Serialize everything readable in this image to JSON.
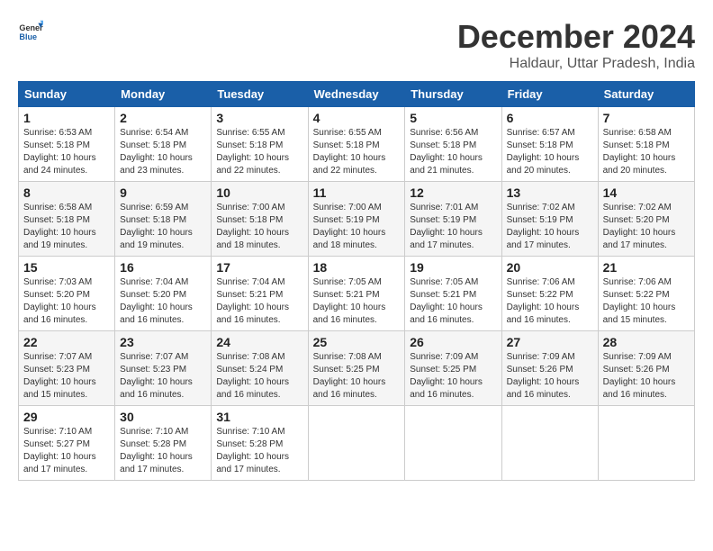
{
  "header": {
    "logo_general": "General",
    "logo_blue": "Blue",
    "title": "December 2024",
    "subtitle": "Haldaur, Uttar Pradesh, India"
  },
  "days_of_week": [
    "Sunday",
    "Monday",
    "Tuesday",
    "Wednesday",
    "Thursday",
    "Friday",
    "Saturday"
  ],
  "weeks": [
    [
      {
        "day": "1",
        "sunrise": "6:53 AM",
        "sunset": "5:18 PM",
        "daylight": "10 hours and 24 minutes."
      },
      {
        "day": "2",
        "sunrise": "6:54 AM",
        "sunset": "5:18 PM",
        "daylight": "10 hours and 23 minutes."
      },
      {
        "day": "3",
        "sunrise": "6:55 AM",
        "sunset": "5:18 PM",
        "daylight": "10 hours and 22 minutes."
      },
      {
        "day": "4",
        "sunrise": "6:55 AM",
        "sunset": "5:18 PM",
        "daylight": "10 hours and 22 minutes."
      },
      {
        "day": "5",
        "sunrise": "6:56 AM",
        "sunset": "5:18 PM",
        "daylight": "10 hours and 21 minutes."
      },
      {
        "day": "6",
        "sunrise": "6:57 AM",
        "sunset": "5:18 PM",
        "daylight": "10 hours and 20 minutes."
      },
      {
        "day": "7",
        "sunrise": "6:58 AM",
        "sunset": "5:18 PM",
        "daylight": "10 hours and 20 minutes."
      }
    ],
    [
      {
        "day": "8",
        "sunrise": "6:58 AM",
        "sunset": "5:18 PM",
        "daylight": "10 hours and 19 minutes."
      },
      {
        "day": "9",
        "sunrise": "6:59 AM",
        "sunset": "5:18 PM",
        "daylight": "10 hours and 19 minutes."
      },
      {
        "day": "10",
        "sunrise": "7:00 AM",
        "sunset": "5:18 PM",
        "daylight": "10 hours and 18 minutes."
      },
      {
        "day": "11",
        "sunrise": "7:00 AM",
        "sunset": "5:19 PM",
        "daylight": "10 hours and 18 minutes."
      },
      {
        "day": "12",
        "sunrise": "7:01 AM",
        "sunset": "5:19 PM",
        "daylight": "10 hours and 17 minutes."
      },
      {
        "day": "13",
        "sunrise": "7:02 AM",
        "sunset": "5:19 PM",
        "daylight": "10 hours and 17 minutes."
      },
      {
        "day": "14",
        "sunrise": "7:02 AM",
        "sunset": "5:20 PM",
        "daylight": "10 hours and 17 minutes."
      }
    ],
    [
      {
        "day": "15",
        "sunrise": "7:03 AM",
        "sunset": "5:20 PM",
        "daylight": "10 hours and 16 minutes."
      },
      {
        "day": "16",
        "sunrise": "7:04 AM",
        "sunset": "5:20 PM",
        "daylight": "10 hours and 16 minutes."
      },
      {
        "day": "17",
        "sunrise": "7:04 AM",
        "sunset": "5:21 PM",
        "daylight": "10 hours and 16 minutes."
      },
      {
        "day": "18",
        "sunrise": "7:05 AM",
        "sunset": "5:21 PM",
        "daylight": "10 hours and 16 minutes."
      },
      {
        "day": "19",
        "sunrise": "7:05 AM",
        "sunset": "5:21 PM",
        "daylight": "10 hours and 16 minutes."
      },
      {
        "day": "20",
        "sunrise": "7:06 AM",
        "sunset": "5:22 PM",
        "daylight": "10 hours and 16 minutes."
      },
      {
        "day": "21",
        "sunrise": "7:06 AM",
        "sunset": "5:22 PM",
        "daylight": "10 hours and 15 minutes."
      }
    ],
    [
      {
        "day": "22",
        "sunrise": "7:07 AM",
        "sunset": "5:23 PM",
        "daylight": "10 hours and 15 minutes."
      },
      {
        "day": "23",
        "sunrise": "7:07 AM",
        "sunset": "5:23 PM",
        "daylight": "10 hours and 16 minutes."
      },
      {
        "day": "24",
        "sunrise": "7:08 AM",
        "sunset": "5:24 PM",
        "daylight": "10 hours and 16 minutes."
      },
      {
        "day": "25",
        "sunrise": "7:08 AM",
        "sunset": "5:25 PM",
        "daylight": "10 hours and 16 minutes."
      },
      {
        "day": "26",
        "sunrise": "7:09 AM",
        "sunset": "5:25 PM",
        "daylight": "10 hours and 16 minutes."
      },
      {
        "day": "27",
        "sunrise": "7:09 AM",
        "sunset": "5:26 PM",
        "daylight": "10 hours and 16 minutes."
      },
      {
        "day": "28",
        "sunrise": "7:09 AM",
        "sunset": "5:26 PM",
        "daylight": "10 hours and 16 minutes."
      }
    ],
    [
      {
        "day": "29",
        "sunrise": "7:10 AM",
        "sunset": "5:27 PM",
        "daylight": "10 hours and 17 minutes."
      },
      {
        "day": "30",
        "sunrise": "7:10 AM",
        "sunset": "5:28 PM",
        "daylight": "10 hours and 17 minutes."
      },
      {
        "day": "31",
        "sunrise": "7:10 AM",
        "sunset": "5:28 PM",
        "daylight": "10 hours and 17 minutes."
      },
      null,
      null,
      null,
      null
    ]
  ]
}
